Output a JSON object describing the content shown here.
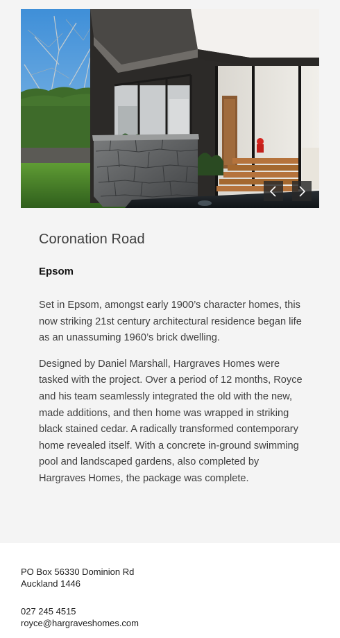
{
  "gallery": {
    "prev_icon": "chevron-left-icon",
    "next_icon": "chevron-right-icon"
  },
  "project": {
    "title": "Coronation Road",
    "suburb": "Epsom",
    "paragraphs": [
      "Set in Epsom, amongst early 1900’s character homes, this now striking 21st century architectural residence began life as an unassuming 1960’s brick dwelling.",
      "Designed by Daniel Marshall, Hargraves Homes were tasked with the project. Over a period of 12 months, Royce and his team seamlessly integrated the old with the new, made additions, and then home was wrapped in striking black stained cedar. A radically transformed contemporary home revealed itself. With a concrete in-ground swimming pool and landscaped gardens, also completed by Hargraves Homes, the package was complete."
    ]
  },
  "footer": {
    "address_line1": "PO Box 56330 Dominion Rd",
    "address_line2": "Auckland 1446",
    "phone": "027 245 4515",
    "email": "royce@hargraveshomes.com"
  }
}
